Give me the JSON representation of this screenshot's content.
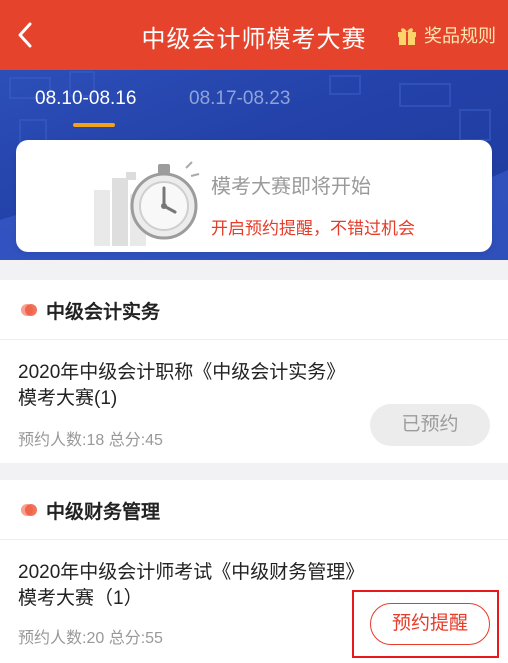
{
  "header": {
    "title": "中级会计师模考大赛",
    "rules_label": "奖品规则",
    "bg_color": "#e5432c"
  },
  "tabs": [
    {
      "label": "08.10-08.16",
      "active": true
    },
    {
      "label": "08.17-08.23",
      "active": false
    }
  ],
  "notice": {
    "title": "模考大赛即将开始",
    "subtitle": "开启预约提醒，不错过机会"
  },
  "sections": [
    {
      "name": "中级会计实务",
      "exam_title": "2020年中级会计职称《中级会计实务》模考大赛(1)",
      "meta": "预约人数:18  总分:45",
      "button_label": "已预约",
      "button_state": "booked"
    },
    {
      "name": "中级财务管理",
      "exam_title": "2020年中级会计师考试《中级财务管理》模考大赛（1）",
      "meta": "预约人数:20  总分:55",
      "button_label": "预约提醒",
      "button_state": "remind"
    }
  ],
  "colors": {
    "accent": "#e63c2a",
    "hero_blue": "#2341a8",
    "tab_underline": "#f0a21c"
  }
}
